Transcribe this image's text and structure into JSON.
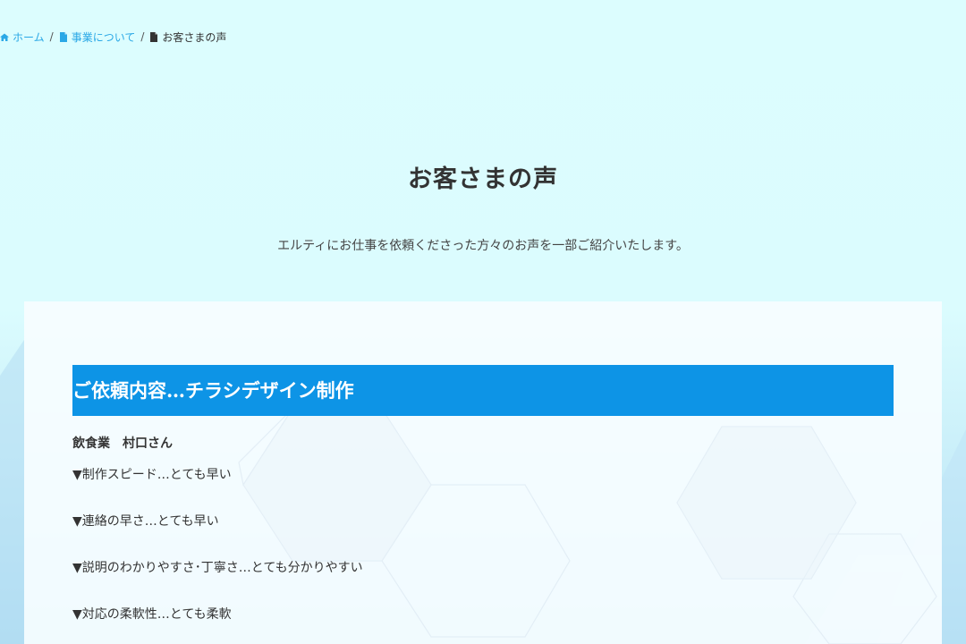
{
  "breadcrumb": {
    "items": [
      {
        "label": "ホーム",
        "icon": "home-icon",
        "link": true
      },
      {
        "label": "事業について",
        "icon": "document-icon",
        "link": true
      },
      {
        "label": "お客さまの声",
        "icon": "document-icon",
        "link": false
      }
    ],
    "separator": "/"
  },
  "page": {
    "title": "お客さまの声",
    "lead": "エルティにお仕事を依頼くださった方々のお声を一部ご紹介いたします。"
  },
  "review": {
    "heading": "ご依頼内容…チラシデザイン制作",
    "client": "飲食業　村口さん",
    "items": [
      "▼制作スピード…とても早い",
      "▼連絡の早さ…とても早い",
      "▼説明のわかりやすさ･丁寧さ…とても分かりやすい",
      "▼対応の柔軟性…とても柔軟"
    ]
  },
  "colors": {
    "background": "#dcfdfe",
    "link": "#2aa8e6",
    "heading_bar": "#0d94e6",
    "panel": "#f6fdff"
  }
}
